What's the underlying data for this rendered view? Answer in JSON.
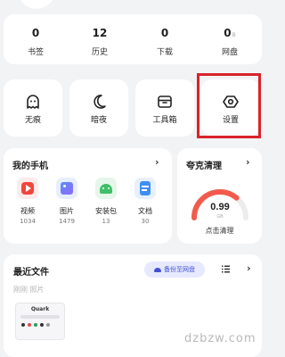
{
  "stats": [
    {
      "value": "0",
      "label": "书签",
      "sup": ""
    },
    {
      "value": "12",
      "label": "历史",
      "sup": ""
    },
    {
      "value": "0",
      "label": "下载",
      "sup": ""
    },
    {
      "value": "0",
      "label": "网盘",
      "sup": "B"
    }
  ],
  "tools": [
    {
      "label": "无痕",
      "icon": "ghost-icon"
    },
    {
      "label": "暗夜",
      "icon": "moon-icon"
    },
    {
      "label": "工具箱",
      "icon": "toolbox-icon"
    },
    {
      "label": "设置",
      "icon": "gear-icon"
    }
  ],
  "my_phone": {
    "title": "我的手机",
    "chevron": "›",
    "apps": [
      {
        "name": "视频",
        "count": "1034",
        "icon": "video-icon",
        "color": "#f0463c"
      },
      {
        "name": "图片",
        "count": "1479",
        "icon": "image-icon",
        "color": "#4f86f7"
      },
      {
        "name": "安装包",
        "count": "13",
        "icon": "android-icon",
        "color": "#3fbf6a"
      },
      {
        "name": "文档",
        "count": "30",
        "icon": "document-icon",
        "color": "#3f8ef5"
      }
    ]
  },
  "clean": {
    "title": "夸克清理",
    "chevron": "›",
    "value": "0.99",
    "unit": "GB",
    "button": "点击清理",
    "gauge_fraction": 0.72,
    "gauge_color": "#f25b4c"
  },
  "recent": {
    "title": "最近文件",
    "backup_label": "备份至网盘",
    "tabs": "刚刚 照片",
    "thumb_title": "Quark",
    "chevron": "›"
  },
  "watermark": "dzbzw.com"
}
